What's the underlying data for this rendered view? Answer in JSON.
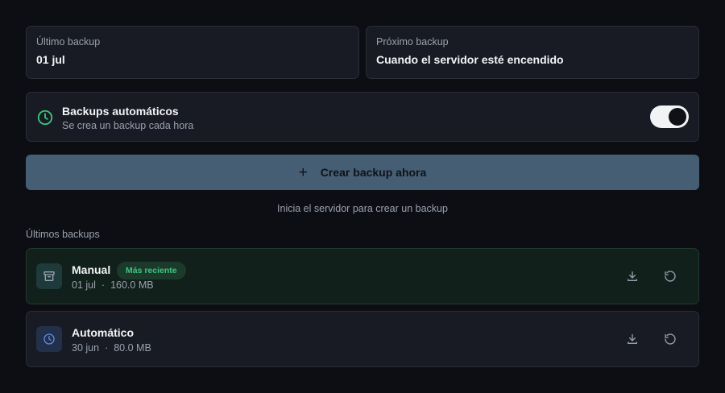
{
  "last_backup": {
    "label": "Último backup",
    "value": "01 jul"
  },
  "next_backup": {
    "label": "Próximo backup",
    "value": "Cuando el servidor esté encendido"
  },
  "auto_backups": {
    "title": "Backups automáticos",
    "subtitle": "Se crea un backup cada hora",
    "enabled": true,
    "icon": "clock-icon",
    "accent_color": "#3ec47e"
  },
  "create_button": {
    "icon": "plus-icon",
    "label": "Crear backup ahora"
  },
  "hint": "Inicia el servidor para crear un backup",
  "section_title": "Últimos backups",
  "backups": [
    {
      "title": "Manual",
      "badge": "Más reciente",
      "date": "01 jul",
      "separator": "·",
      "size": "160.0 MB",
      "icon": "archive-icon"
    },
    {
      "title": "Automático",
      "date": "30 jun",
      "separator": "·",
      "size": "80.0 MB",
      "icon": "clock-icon"
    }
  ]
}
